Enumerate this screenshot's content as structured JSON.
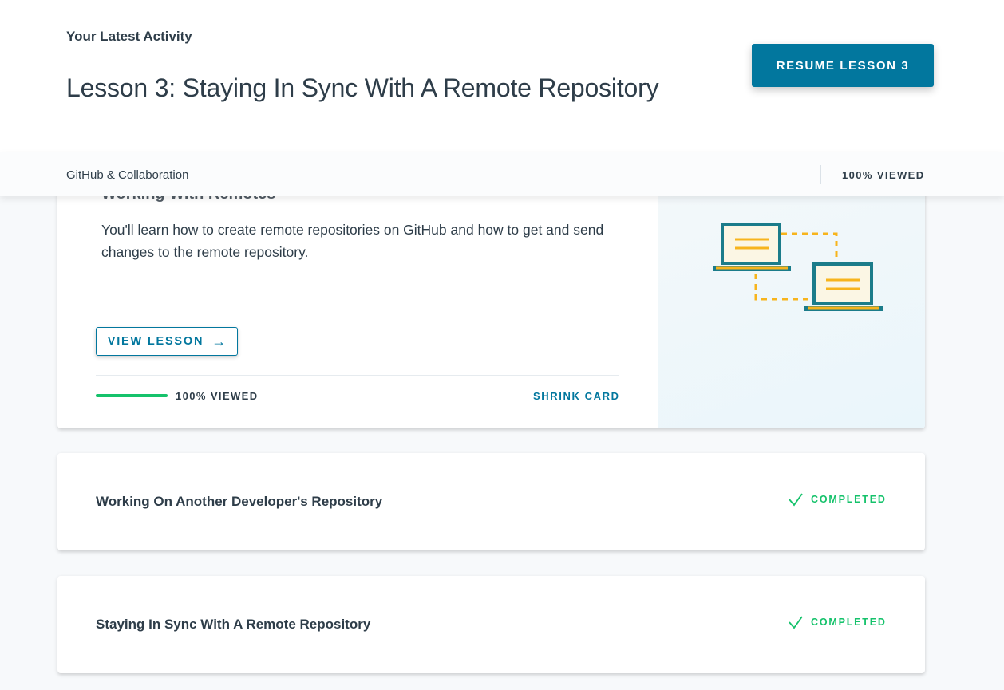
{
  "header": {
    "activity_label": "Your Latest Activity",
    "lesson_title": "Lesson 3: Staying In Sync With A Remote Repository",
    "resume_button": "RESUME LESSON 3"
  },
  "course_bar": {
    "course_name": "GitHub & Collaboration",
    "viewed": "100% VIEWED"
  },
  "expanded_card": {
    "heading": "Working With Remotes",
    "description": "You'll learn how to create remote repositories on GitHub and how to get and send changes to the remote repository.",
    "view_button": "VIEW LESSON",
    "progress_fraction": 1.0,
    "progress_label": "100% VIEWED",
    "shrink_label": "SHRINK CARD",
    "illustration_icon": "two-laptops-sync-icon"
  },
  "lessons": [
    {
      "title": "Working On Another Developer's Repository",
      "status": "COMPLETED",
      "status_icon": "checkmark-icon"
    },
    {
      "title": "Staying In Sync With A Remote Repository",
      "status": "COMPLETED",
      "status_icon": "checkmark-icon"
    }
  ],
  "colors": {
    "accent": "#02779e",
    "success": "#15c26b",
    "text": "#2e3d49",
    "background": "#f7f9fb",
    "illustration_teal": "#1b7c8a",
    "illustration_orange": "#f7b41c"
  }
}
